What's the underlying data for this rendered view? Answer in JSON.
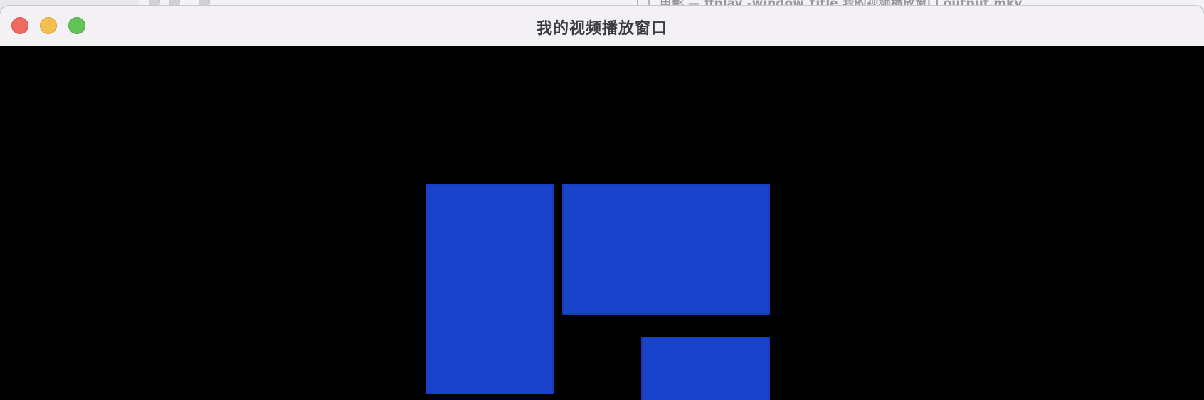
{
  "window": {
    "title": "我的视频播放窗口",
    "traffic_lights": [
      "close",
      "minimize",
      "zoom"
    ]
  },
  "background_window": {
    "title_fragment": "电影 — ffplay -window_title 我的视频播放窗口 output.mkv"
  },
  "video": {
    "background_color": "#000000",
    "block_color": "#1a43cc"
  }
}
